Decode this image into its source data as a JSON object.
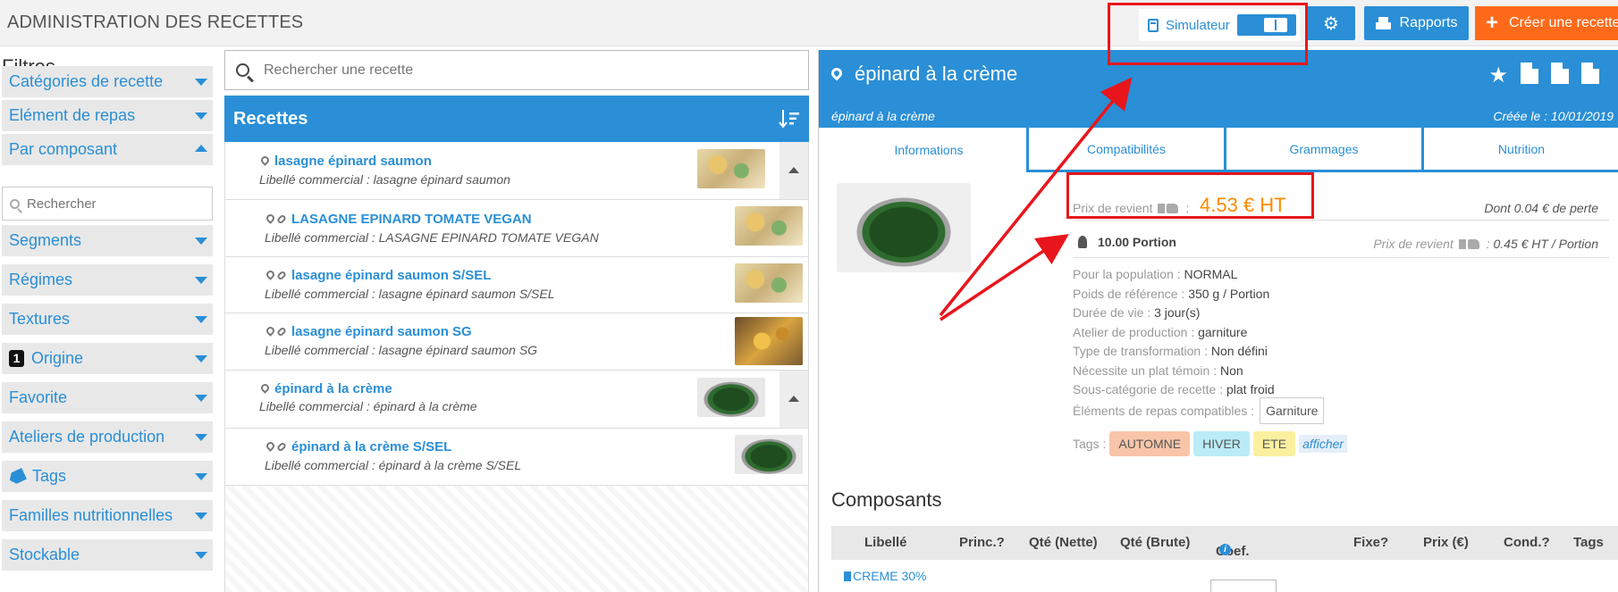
{
  "header": {
    "title": "ADMINISTRATION DES RECETTES",
    "simulator_label": "Simulateur",
    "rapports_label": "Rapports",
    "create_label": "Créer une recette"
  },
  "filters": {
    "title": "Filtres",
    "search_placeholder": "Rechercher",
    "items": [
      {
        "label": "Catégories de recette"
      },
      {
        "label": "Elément de repas"
      },
      {
        "label": "Par composant"
      },
      {
        "label": "Segments"
      },
      {
        "label": "Régimes"
      },
      {
        "label": "Textures"
      },
      {
        "label": "Origine",
        "badge": "1"
      },
      {
        "label": "Favorite"
      },
      {
        "label": "Ateliers de production"
      },
      {
        "label": "Tags"
      },
      {
        "label": "Familles nutritionnelles"
      },
      {
        "label": "Stockable"
      }
    ]
  },
  "recipes": {
    "search_placeholder": "Rechercher une recette",
    "header": "Recettes",
    "items": [
      {
        "name": "lasagne épinard saumon",
        "commercial": "Libellé commercial : lasagne épinard saumon"
      },
      {
        "name": "LASAGNE EPINARD TOMATE VEGAN",
        "commercial": "Libellé commercial : LASAGNE EPINARD TOMATE VEGAN"
      },
      {
        "name": "lasagne épinard saumon S/SEL",
        "commercial": "Libellé commercial : lasagne épinard saumon S/SEL"
      },
      {
        "name": "lasagne épinard saumon SG",
        "commercial": "Libellé commercial : lasagne épinard saumon SG"
      },
      {
        "name": "épinard à la crème",
        "commercial": "Libellé commercial : épinard à la crème"
      },
      {
        "name": "épinard à la crème S/SEL",
        "commercial": "Libellé commercial : épinard à la crème S/SEL"
      }
    ]
  },
  "detail": {
    "title": "épinard à la crème",
    "subtitle": "épinard à la crème",
    "created": "Créée le : 10/01/2019",
    "tabs": [
      "Informations",
      "Compatibilités",
      "Grammages",
      "Nutrition"
    ],
    "cost_label": "Prix de revient",
    "cost_value": "4.53  € HT",
    "loss": "Dont 0.04 € de perte",
    "portion": "10.00 Portion",
    "portion_cost_label": "Prix de revient",
    "portion_cost_value": "0.45 € HT / Portion",
    "info": [
      {
        "k": "Pour la population : ",
        "v": "NORMAL"
      },
      {
        "k": "Poids de référence : ",
        "v": "350 g / Portion"
      },
      {
        "k": "Durée de vie : ",
        "v": "3 jour(s)"
      },
      {
        "k": "Atelier de production : ",
        "v": "garniture"
      },
      {
        "k": "Type de transformation : ",
        "v": "Non défini"
      },
      {
        "k": "Nécessite un plat témoin : ",
        "v": "Non"
      },
      {
        "k": "Sous-catégorie de recette : ",
        "v": "plat froid"
      }
    ],
    "compat_label": "Éléments de repas compatibles :",
    "compat_value": "Garniture",
    "tags_label": "Tags :",
    "tags": [
      "AUTOMNE",
      "HIVER",
      "ETE"
    ],
    "tags_show": "afficher",
    "components_title": "Composants",
    "columns": [
      "Libellé",
      "Princ.?",
      "Qté (Nette)",
      "Qté (Brute)",
      "Coef.",
      "Fixe?",
      "Prix (€)",
      "Cond.?",
      "Tags"
    ],
    "first_component": "CREME 30%"
  },
  "colors": {
    "accent": "#2a8fd6",
    "create": "#ff6a1a",
    "cost": "#ff8a00",
    "annotation": "#e8161c"
  }
}
